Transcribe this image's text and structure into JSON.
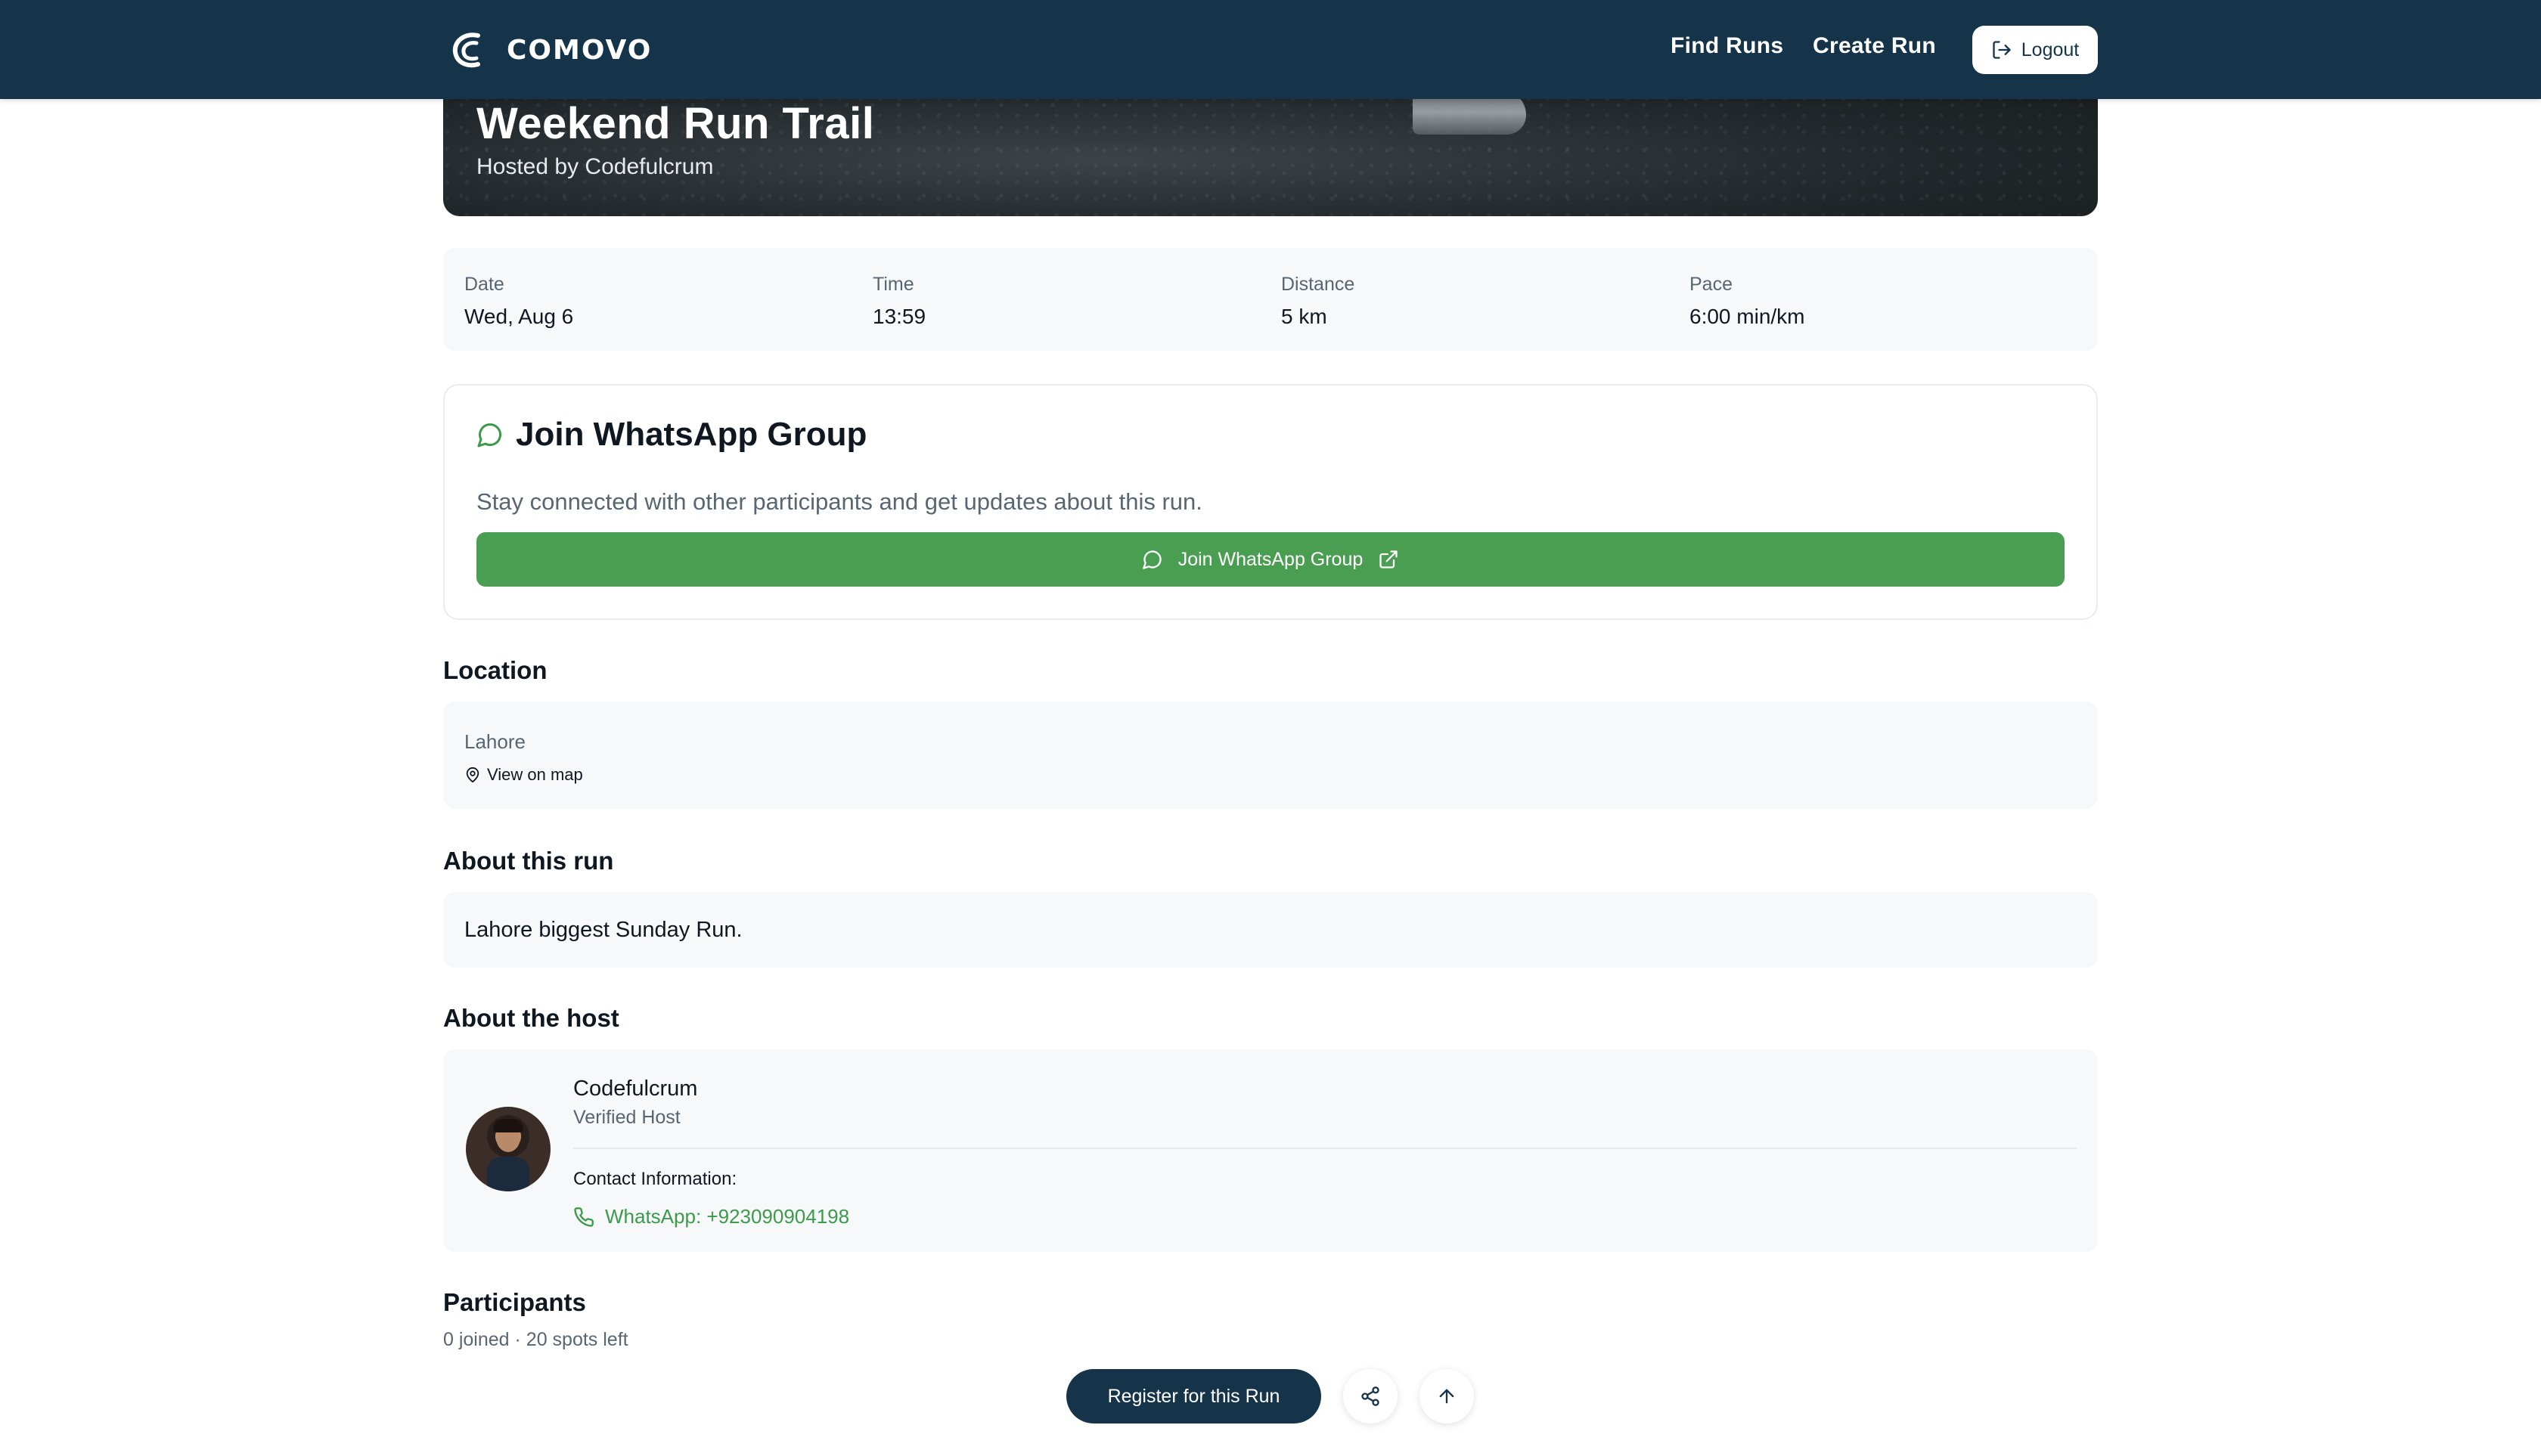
{
  "navbar": {
    "brand": "COMOVO",
    "links": [
      {
        "label": "Find Runs"
      },
      {
        "label": "Create Run"
      }
    ],
    "logout_label": "Logout"
  },
  "hero": {
    "title": "Weekend Run Trail",
    "subtitle": "Hosted by Codefulcrum"
  },
  "details": [
    {
      "label": "Date",
      "value": "Wed, Aug 6"
    },
    {
      "label": "Time",
      "value": "13:59"
    },
    {
      "label": "Distance",
      "value": "5 km"
    },
    {
      "label": "Pace",
      "value": "6:00 min/km"
    }
  ],
  "whatsapp": {
    "title": "Join WhatsApp Group",
    "description": "Stay connected with other participants and get updates about this run.",
    "button_label": "Join WhatsApp Group",
    "color": "#4a9e52"
  },
  "location": {
    "heading": "Location",
    "city": "Lahore",
    "map_link": "View on map"
  },
  "about_run": {
    "heading": "About this run",
    "text": "Lahore biggest Sunday Run."
  },
  "host": {
    "heading": "About the host",
    "name": "Codefulcrum",
    "badge": "Verified Host",
    "contact_label": "Contact Information:",
    "phone": "WhatsApp: +923090904198"
  },
  "participants": {
    "heading": "Participants",
    "summary": "0 joined · 20 spots left"
  },
  "actions": {
    "register_label": "Register for this Run",
    "share_icon": "share-icon",
    "top_icon": "arrow-up-icon"
  },
  "colors": {
    "navbar": "#15344a",
    "accent_green": "#4a9e52"
  }
}
